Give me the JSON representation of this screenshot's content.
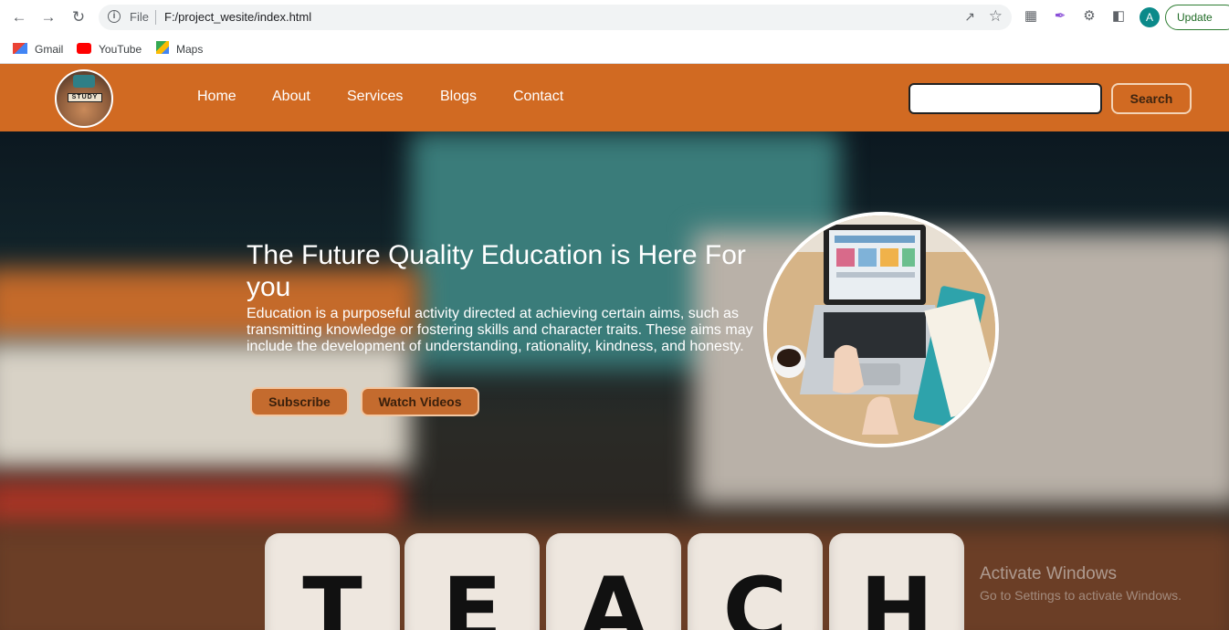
{
  "browser": {
    "url_scheme": "File",
    "url": "F:/project_wesite/index.html",
    "update_label": "Update",
    "avatar_letter": "A",
    "bookmarks": [
      {
        "label": "Gmail",
        "icon": "gmail-icon"
      },
      {
        "label": "YouTube",
        "icon": "youtube-icon"
      },
      {
        "label": "Maps",
        "icon": "maps-icon"
      }
    ]
  },
  "site": {
    "logo_text": "STUDY",
    "nav": [
      "Home",
      "About",
      "Services",
      "Blogs",
      "Contact"
    ],
    "search_placeholder": "",
    "search_button": "Search",
    "accent_color": "#d16a22"
  },
  "hero": {
    "title": "The Future Quality Education is Here For you",
    "text": "Education is a purposeful activity directed at achieving certain aims, such as transmitting knowledge or fostering skills and character traits. These aims may include the development of understanding, rationality, kindness, and honesty.",
    "buttons": [
      "Subscribe",
      "Watch Videos"
    ],
    "dice_letters": [
      "T",
      "E",
      "A",
      "C",
      "H"
    ],
    "image_alt": "laptop-on-desk illustration"
  },
  "watermark": {
    "line1": "Activate Windows",
    "line2": "Go to Settings to activate Windows."
  }
}
